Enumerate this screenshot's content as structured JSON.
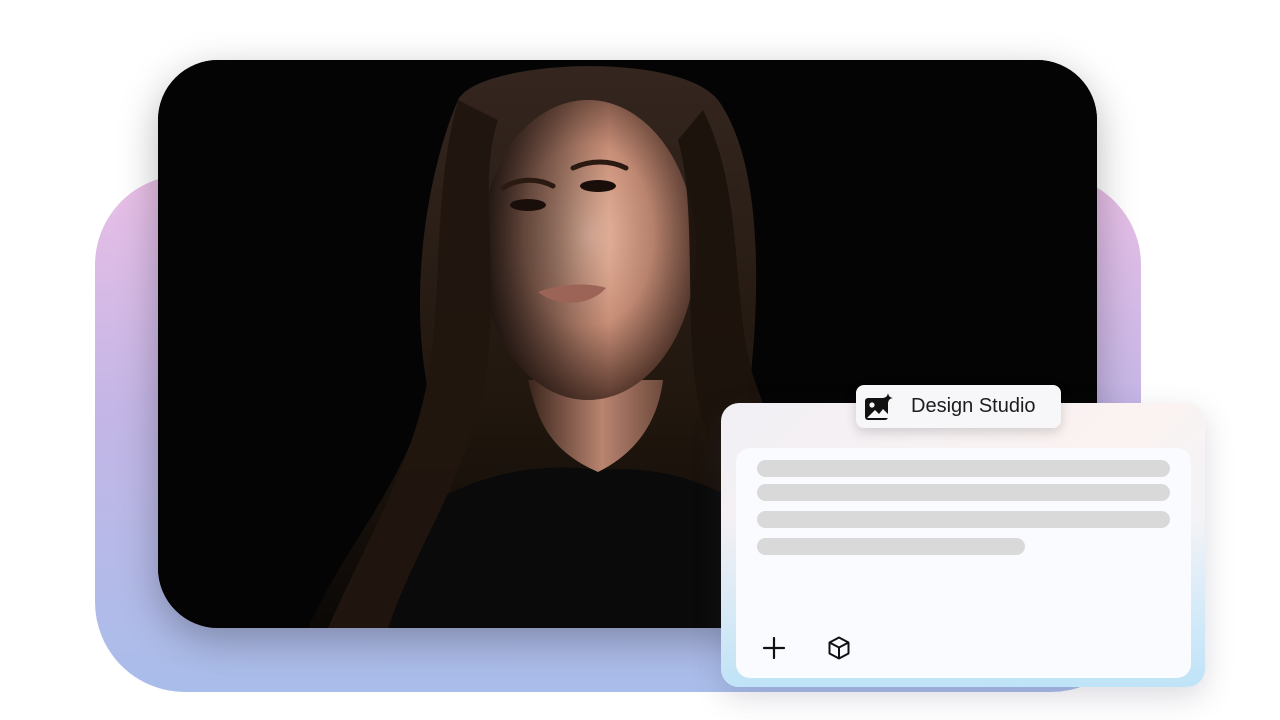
{
  "badge": {
    "label": "Design Studio",
    "icon": "image-sparkle-icon"
  },
  "toolbar": {
    "add_icon": "plus-icon",
    "model_icon": "cube-icon"
  },
  "colors": {
    "backdrop_top": "#e9bfe6",
    "backdrop_bottom": "#a9bdea",
    "placeholder_line": "#d9d9d9",
    "photo_background": "#040404"
  }
}
